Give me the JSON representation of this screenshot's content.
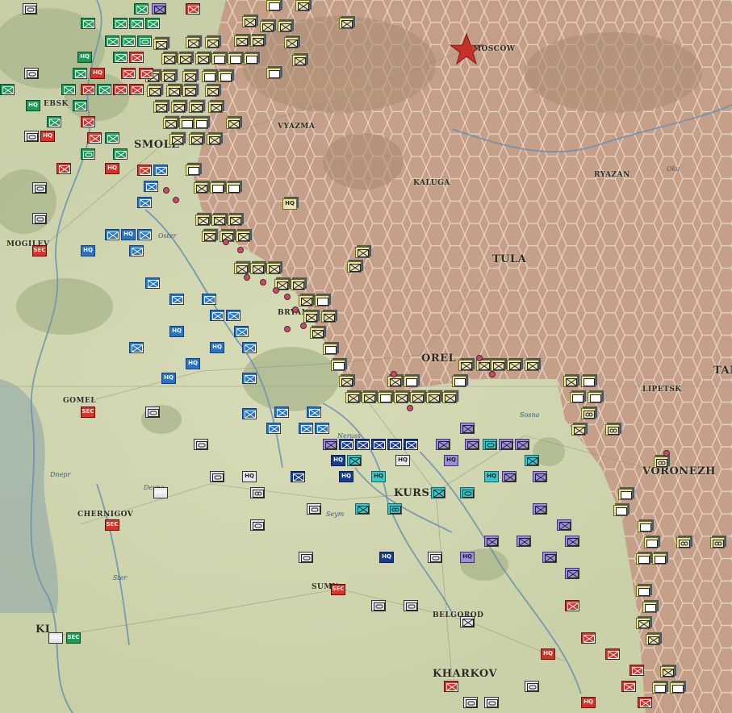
{
  "map": {
    "cities": [
      {
        "name": "MOSCOW",
        "size": "small"
      },
      {
        "name": "SMOLE",
        "size": "big"
      },
      {
        "name": "VYAZMA",
        "size": "small"
      },
      {
        "name": "KALUGA",
        "size": "small"
      },
      {
        "name": "RYAZAN",
        "size": "small"
      },
      {
        "name": "TULA",
        "size": "big"
      },
      {
        "name": "OREL",
        "size": "big"
      },
      {
        "name": "BRYANSK",
        "size": "small"
      },
      {
        "name": "MOGILEV",
        "size": "small"
      },
      {
        "name": "GOMEL",
        "size": "small"
      },
      {
        "name": "CHERNIGOV",
        "size": "small"
      },
      {
        "name": "KURSK",
        "size": "big"
      },
      {
        "name": "SUMY",
        "size": "small"
      },
      {
        "name": "BELGOROD",
        "size": "small"
      },
      {
        "name": "KHARKOV",
        "size": "big"
      },
      {
        "name": "VORONEZH",
        "size": "big"
      },
      {
        "name": "LIPETSK",
        "size": "small"
      },
      {
        "name": "EBSK",
        "size": "small"
      },
      {
        "name": "KI",
        "size": "big"
      },
      {
        "name": "TAM",
        "size": "big"
      }
    ],
    "rivers": [
      "Oster",
      "Neruss",
      "Seym",
      "Sosna",
      "Oka",
      "Desna",
      "Dnepr",
      "Ster"
    ],
    "colors": {
      "soviet_zone": "#c49a85",
      "hex_grid": "#e6d3c2",
      "terrain": "#c9cfa6",
      "river": "#6b8fb0",
      "soviet_counter": "#e8e2b6",
      "soviet_border": "#6b6b1a",
      "german_blue": "#2a72c4",
      "german_navy": "#1c3b8e",
      "german_green": "#1f9a55",
      "german_red": "#d0352b",
      "german_white": "#e8e8ec",
      "hungarian_purple": "#9e8ed6",
      "romanian_cyan": "#38c6c9",
      "sec_red": "#d8342a"
    }
  },
  "counter_types": {
    "infantry": "infantry-icon",
    "armor": "armor-icon",
    "motorized": "motorized-icon",
    "headquarters": "HQ",
    "security": "SEC"
  }
}
